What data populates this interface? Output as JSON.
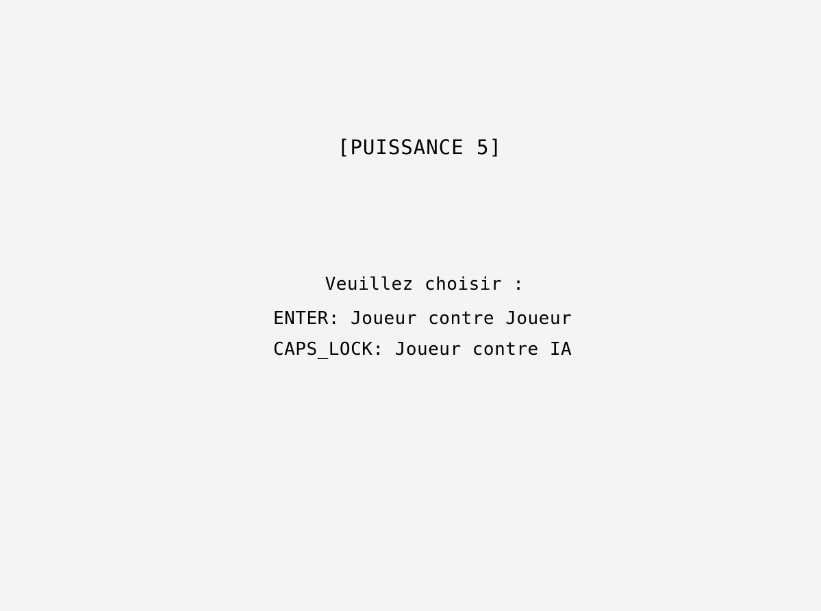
{
  "game": {
    "title": "[PUISSANCE 5]",
    "prompt": "Veuillez choisir :",
    "options": [
      {
        "label": "ENTER: Joueur contre Joueur"
      },
      {
        "label": "CAPS_LOCK: Joueur contre IA"
      }
    ]
  },
  "colors": {
    "background": "#f4f4f4",
    "text": "#000000"
  }
}
